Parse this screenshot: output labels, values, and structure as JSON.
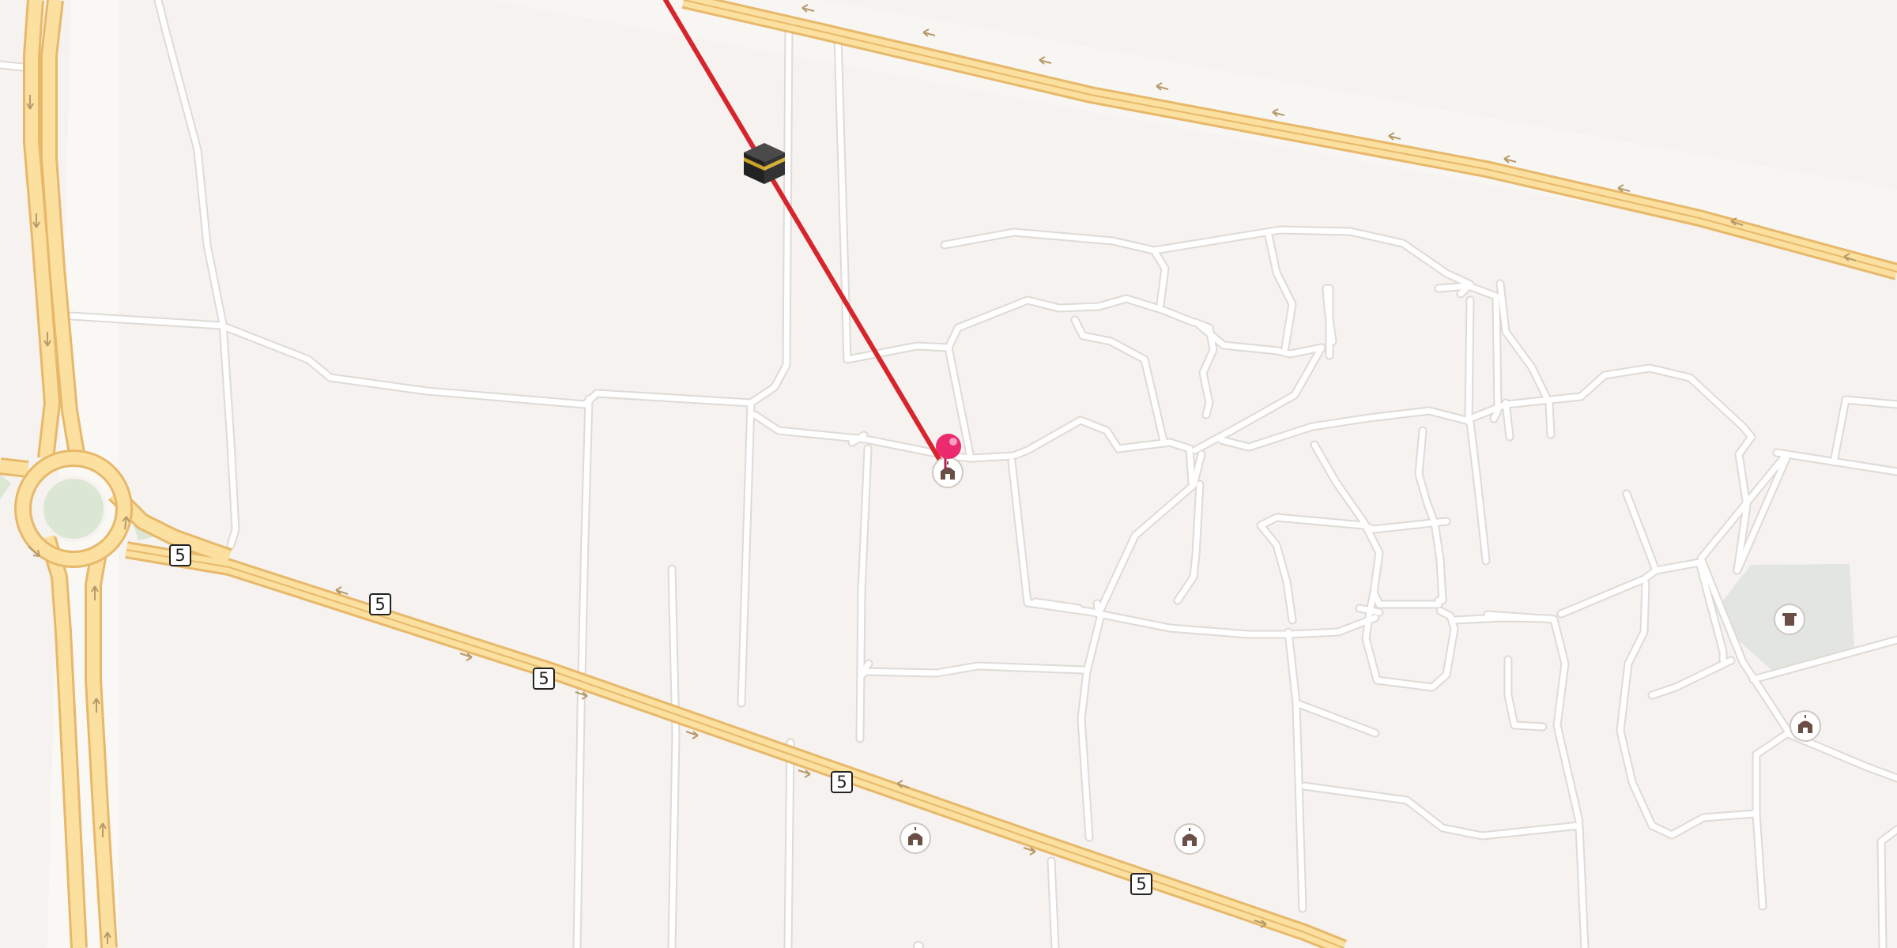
{
  "map": {
    "route_shield_label": "5",
    "colors": {
      "background": "#f5f2ef",
      "lane_tint": "#faf8f5",
      "street": "#ffffff",
      "street_casing": "#dedad6",
      "highway_fill": "#fbe0a0",
      "highway_casing": "#e8b86a",
      "direction_arrow": "#b89a6a",
      "park": "#dbe7d3",
      "cemetery": "#e3e6e0",
      "qibla_line": "#d6252d",
      "pin": "#ec2a6d",
      "poi_icon": "#6b4e45"
    },
    "icons": {
      "kaaba": "kaaba-icon",
      "location_pin": "location-pin-icon",
      "mosque": "mosque-icon",
      "cemetery": "cemetery-icon"
    }
  }
}
